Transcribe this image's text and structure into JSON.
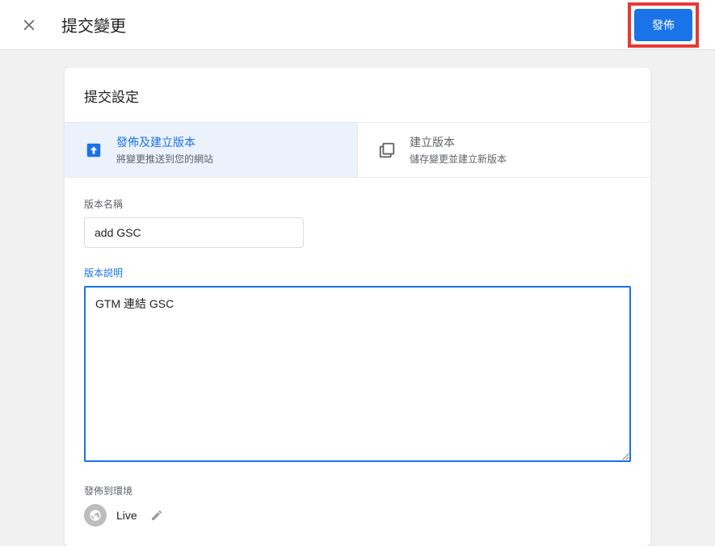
{
  "header": {
    "title": "提交變更",
    "publish_button": "發佈"
  },
  "card": {
    "title": "提交設定",
    "tabs": [
      {
        "title": "發佈及建立版本",
        "desc": "將變更推送到您的網站"
      },
      {
        "title": "建立版本",
        "desc": "儲存變更並建立新版本"
      }
    ],
    "fields": {
      "version_name_label": "版本名稱",
      "version_name_value": "add GSC",
      "version_desc_label": "版本説明",
      "version_desc_value": "GTM 連結 GSC"
    },
    "env": {
      "label": "發佈到環境",
      "name": "Live"
    }
  }
}
